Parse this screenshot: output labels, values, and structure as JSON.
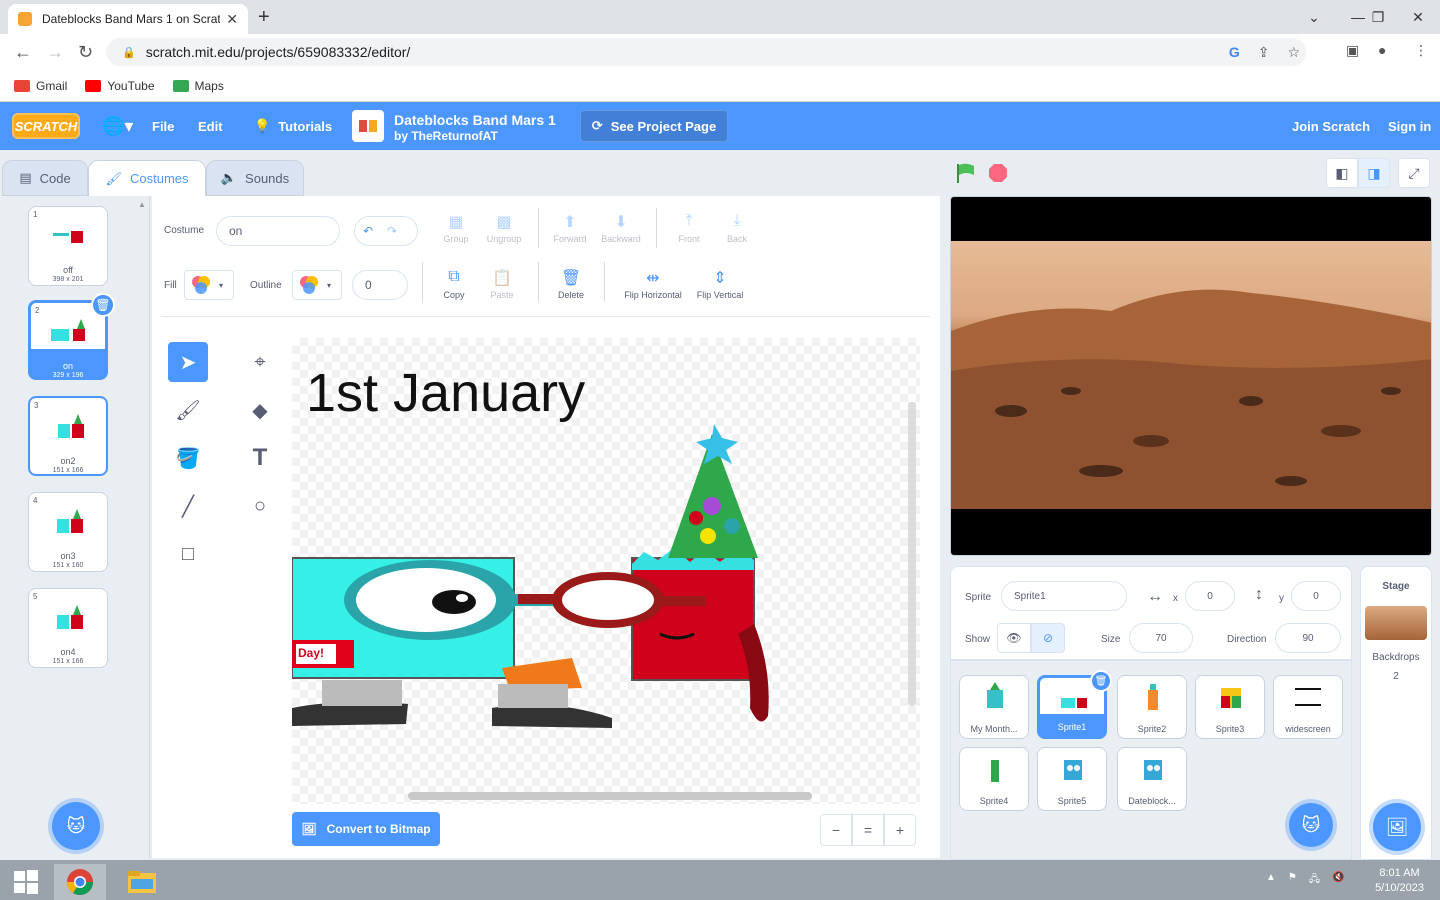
{
  "browser": {
    "tab_title": "Dateblocks Band Mars 1 on Scrat",
    "url": "scratch.mit.edu/projects/659083332/editor/",
    "bookmarks": [
      {
        "label": "Gmail",
        "color": "#ea4335"
      },
      {
        "label": "YouTube",
        "color": "#ff0000"
      },
      {
        "label": "Maps",
        "color": "#34a853"
      }
    ]
  },
  "menubar": {
    "logo": "SCRATCH",
    "file": "File",
    "edit": "Edit",
    "tutorials": "Tutorials",
    "project_title": "Dateblocks Band Mars 1",
    "project_author": "by TheReturnofAT",
    "see_project": "See Project Page",
    "join": "Join Scratch",
    "signin": "Sign in"
  },
  "tabs": {
    "code": "Code",
    "costumes": "Costumes",
    "sounds": "Sounds"
  },
  "costumes": [
    {
      "num": "1",
      "name": "off",
      "dims": "398 x 201"
    },
    {
      "num": "2",
      "name": "on",
      "dims": "329 x 196",
      "selected": true
    },
    {
      "num": "3",
      "name": "on2",
      "dims": "151 x 166"
    },
    {
      "num": "4",
      "name": "on3",
      "dims": "151 x 160"
    },
    {
      "num": "5",
      "name": "on4",
      "dims": "151 x 166"
    }
  ],
  "paint": {
    "costume_label": "Costume",
    "costume_name": "on",
    "fill_label": "Fill",
    "outline_label": "Outline",
    "outline_width": "0",
    "group": "Group",
    "ungroup": "Ungroup",
    "forward": "Forward",
    "backward": "Backward",
    "front": "Front",
    "back": "Back",
    "copy": "Copy",
    "paste": "Paste",
    "delete": "Delete",
    "flip_h": "Flip Horizontal",
    "flip_v": "Flip Vertical",
    "canvas_text": "1st January",
    "day_text": "Day!",
    "convert": "Convert to Bitmap",
    "zoom_out": "−",
    "zoom_reset": "=",
    "zoom_in": "+"
  },
  "sprite_info": {
    "sprite_label": "Sprite",
    "sprite_name": "Sprite1",
    "x_label": "x",
    "x": "0",
    "y_label": "y",
    "y": "0",
    "show_label": "Show",
    "size_label": "Size",
    "size": "70",
    "direction_label": "Direction",
    "direction": "90"
  },
  "sprites": [
    {
      "name": "My Month...",
      "color": "#36c0c8"
    },
    {
      "name": "Sprite1",
      "color": "#4c97ff",
      "selected": true
    },
    {
      "name": "Sprite2",
      "color": "#f28b30"
    },
    {
      "name": "Sprite3",
      "color": "#f5c518"
    },
    {
      "name": "widescreen",
      "color": "#111111"
    },
    {
      "name": "Sprite4",
      "color": "#2ea84a"
    },
    {
      "name": "Sprite5",
      "color": "#36a8d8"
    },
    {
      "name": "Dateblock...",
      "color": "#36a8d8"
    }
  ],
  "stage_panel": {
    "title": "Stage",
    "backdrops_label": "Backdrops",
    "backdrops_count": "2"
  },
  "taskbar": {
    "time": "8:01 AM",
    "date": "5/10/2023"
  },
  "colors": {
    "scratch_blue": "#4c97ff",
    "stop_red": "#ff6680",
    "flag_green": "#4cbf56"
  }
}
